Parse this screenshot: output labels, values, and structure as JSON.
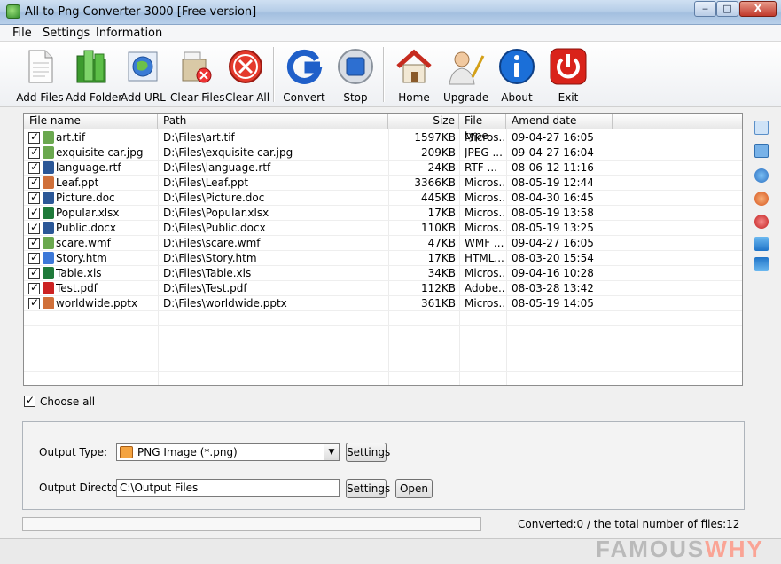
{
  "window": {
    "title": "All to Png Converter 3000 [Free version]",
    "min": "‒",
    "max": "□",
    "close": "X"
  },
  "menu": [
    "File",
    "Settings",
    "Information"
  ],
  "toolbar": [
    {
      "label": "Add Files",
      "icon": "document-icon"
    },
    {
      "label": "Add Folder",
      "icon": "folder-icon"
    },
    {
      "label": "Add URL",
      "icon": "globe-icon"
    },
    {
      "label": "Clear Files",
      "icon": "clear-files-icon"
    },
    {
      "label": "Clear All",
      "icon": "clear-all-icon"
    },
    {
      "label": "Convert",
      "icon": "convert-icon"
    },
    {
      "label": "Stop",
      "icon": "stop-icon"
    },
    {
      "label": "Home",
      "icon": "home-icon"
    },
    {
      "label": "Upgrade",
      "icon": "upgrade-icon"
    },
    {
      "label": "About",
      "icon": "info-icon"
    },
    {
      "label": "Exit",
      "icon": "power-icon"
    }
  ],
  "columns": [
    "File name",
    "Path",
    "Size",
    "File type",
    "Amend date"
  ],
  "files": [
    {
      "name": "art.tif",
      "path": "D:\\Files\\art.tif",
      "size": "1597KB",
      "type": "Micros...",
      "date": "09-04-27 16:05",
      "icon_color": "#6aa84f"
    },
    {
      "name": "exquisite car.jpg",
      "path": "D:\\Files\\exquisite car.jpg",
      "size": "209KB",
      "type": "JPEG ...",
      "date": "09-04-27 16:04",
      "icon_color": "#6aa84f"
    },
    {
      "name": "language.rtf",
      "path": "D:\\Files\\language.rtf",
      "size": "24KB",
      "type": "RTF ...",
      "date": "08-06-12 11:16",
      "icon_color": "#2b5797"
    },
    {
      "name": "Leaf.ppt",
      "path": "D:\\Files\\Leaf.ppt",
      "size": "3366KB",
      "type": "Micros...",
      "date": "08-05-19 12:44",
      "icon_color": "#d0703a"
    },
    {
      "name": "Picture.doc",
      "path": "D:\\Files\\Picture.doc",
      "size": "445KB",
      "type": "Micros...",
      "date": "08-04-30 16:45",
      "icon_color": "#2b5797"
    },
    {
      "name": "Popular.xlsx",
      "path": "D:\\Files\\Popular.xlsx",
      "size": "17KB",
      "type": "Micros...",
      "date": "08-05-19 13:58",
      "icon_color": "#1f7a3a"
    },
    {
      "name": "Public.docx",
      "path": "D:\\Files\\Public.docx",
      "size": "110KB",
      "type": "Micros...",
      "date": "08-05-19 13:25",
      "icon_color": "#2b5797"
    },
    {
      "name": "scare.wmf",
      "path": "D:\\Files\\scare.wmf",
      "size": "47KB",
      "type": "WMF ...",
      "date": "09-04-27 16:05",
      "icon_color": "#6aa84f"
    },
    {
      "name": "Story.htm",
      "path": "D:\\Files\\Story.htm",
      "size": "17KB",
      "type": "HTML...",
      "date": "08-03-20 15:54",
      "icon_color": "#3c78d8"
    },
    {
      "name": "Table.xls",
      "path": "D:\\Files\\Table.xls",
      "size": "34KB",
      "type": "Micros...",
      "date": "09-04-16 10:28",
      "icon_color": "#1f7a3a"
    },
    {
      "name": "Test.pdf",
      "path": "D:\\Files\\Test.pdf",
      "size": "112KB",
      "type": "Adobe...",
      "date": "08-03-28 13:42",
      "icon_color": "#cc2222"
    },
    {
      "name": "worldwide.pptx",
      "path": "D:\\Files\\worldwide.pptx",
      "size": "361KB",
      "type": "Micros...",
      "date": "08-05-19 14:05",
      "icon_color": "#d0703a"
    }
  ],
  "choose_all": "Choose all",
  "output": {
    "type_label": "Output Type:",
    "type_value": "PNG Image (*.png)",
    "dir_label": "Output Directory:",
    "dir_value": "C:\\Output Files",
    "settings": "Settings",
    "open": "Open"
  },
  "status": {
    "converted": "Converted:0  /  the total number of files:12",
    "progress": 0
  },
  "watermark": {
    "main": "FAMOUS",
    "accent": "WHY"
  },
  "colors": {
    "accent": "#2b6cb0",
    "progress": "#5bbd4a"
  }
}
